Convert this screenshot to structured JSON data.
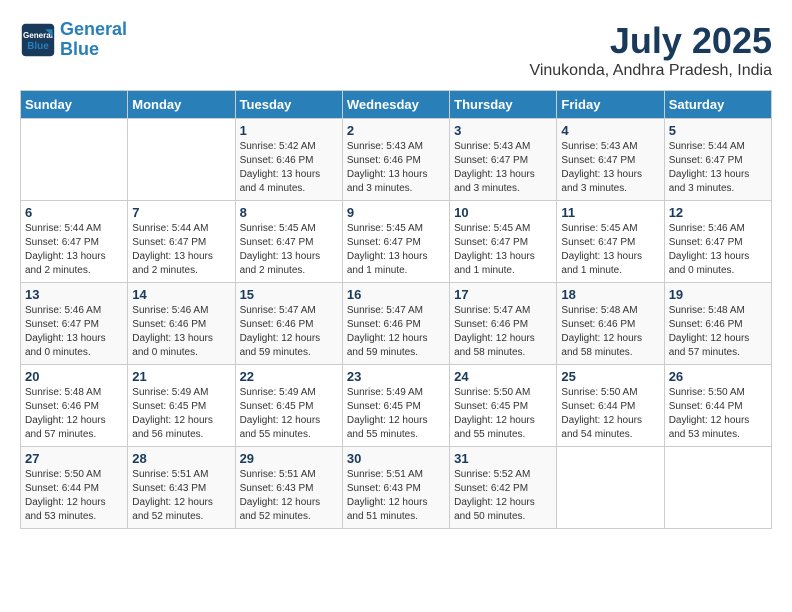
{
  "header": {
    "logo_line1": "General",
    "logo_line2": "Blue",
    "month_title": "July 2025",
    "location": "Vinukonda, Andhra Pradesh, India"
  },
  "days_of_week": [
    "Sunday",
    "Monday",
    "Tuesday",
    "Wednesday",
    "Thursday",
    "Friday",
    "Saturday"
  ],
  "weeks": [
    [
      {
        "day": "",
        "info": ""
      },
      {
        "day": "",
        "info": ""
      },
      {
        "day": "1",
        "info": "Sunrise: 5:42 AM\nSunset: 6:46 PM\nDaylight: 13 hours and 4 minutes."
      },
      {
        "day": "2",
        "info": "Sunrise: 5:43 AM\nSunset: 6:46 PM\nDaylight: 13 hours and 3 minutes."
      },
      {
        "day": "3",
        "info": "Sunrise: 5:43 AM\nSunset: 6:47 PM\nDaylight: 13 hours and 3 minutes."
      },
      {
        "day": "4",
        "info": "Sunrise: 5:43 AM\nSunset: 6:47 PM\nDaylight: 13 hours and 3 minutes."
      },
      {
        "day": "5",
        "info": "Sunrise: 5:44 AM\nSunset: 6:47 PM\nDaylight: 13 hours and 3 minutes."
      }
    ],
    [
      {
        "day": "6",
        "info": "Sunrise: 5:44 AM\nSunset: 6:47 PM\nDaylight: 13 hours and 2 minutes."
      },
      {
        "day": "7",
        "info": "Sunrise: 5:44 AM\nSunset: 6:47 PM\nDaylight: 13 hours and 2 minutes."
      },
      {
        "day": "8",
        "info": "Sunrise: 5:45 AM\nSunset: 6:47 PM\nDaylight: 13 hours and 2 minutes."
      },
      {
        "day": "9",
        "info": "Sunrise: 5:45 AM\nSunset: 6:47 PM\nDaylight: 13 hours and 1 minute."
      },
      {
        "day": "10",
        "info": "Sunrise: 5:45 AM\nSunset: 6:47 PM\nDaylight: 13 hours and 1 minute."
      },
      {
        "day": "11",
        "info": "Sunrise: 5:45 AM\nSunset: 6:47 PM\nDaylight: 13 hours and 1 minute."
      },
      {
        "day": "12",
        "info": "Sunrise: 5:46 AM\nSunset: 6:47 PM\nDaylight: 13 hours and 0 minutes."
      }
    ],
    [
      {
        "day": "13",
        "info": "Sunrise: 5:46 AM\nSunset: 6:47 PM\nDaylight: 13 hours and 0 minutes."
      },
      {
        "day": "14",
        "info": "Sunrise: 5:46 AM\nSunset: 6:46 PM\nDaylight: 13 hours and 0 minutes."
      },
      {
        "day": "15",
        "info": "Sunrise: 5:47 AM\nSunset: 6:46 PM\nDaylight: 12 hours and 59 minutes."
      },
      {
        "day": "16",
        "info": "Sunrise: 5:47 AM\nSunset: 6:46 PM\nDaylight: 12 hours and 59 minutes."
      },
      {
        "day": "17",
        "info": "Sunrise: 5:47 AM\nSunset: 6:46 PM\nDaylight: 12 hours and 58 minutes."
      },
      {
        "day": "18",
        "info": "Sunrise: 5:48 AM\nSunset: 6:46 PM\nDaylight: 12 hours and 58 minutes."
      },
      {
        "day": "19",
        "info": "Sunrise: 5:48 AM\nSunset: 6:46 PM\nDaylight: 12 hours and 57 minutes."
      }
    ],
    [
      {
        "day": "20",
        "info": "Sunrise: 5:48 AM\nSunset: 6:46 PM\nDaylight: 12 hours and 57 minutes."
      },
      {
        "day": "21",
        "info": "Sunrise: 5:49 AM\nSunset: 6:45 PM\nDaylight: 12 hours and 56 minutes."
      },
      {
        "day": "22",
        "info": "Sunrise: 5:49 AM\nSunset: 6:45 PM\nDaylight: 12 hours and 55 minutes."
      },
      {
        "day": "23",
        "info": "Sunrise: 5:49 AM\nSunset: 6:45 PM\nDaylight: 12 hours and 55 minutes."
      },
      {
        "day": "24",
        "info": "Sunrise: 5:50 AM\nSunset: 6:45 PM\nDaylight: 12 hours and 55 minutes."
      },
      {
        "day": "25",
        "info": "Sunrise: 5:50 AM\nSunset: 6:44 PM\nDaylight: 12 hours and 54 minutes."
      },
      {
        "day": "26",
        "info": "Sunrise: 5:50 AM\nSunset: 6:44 PM\nDaylight: 12 hours and 53 minutes."
      }
    ],
    [
      {
        "day": "27",
        "info": "Sunrise: 5:50 AM\nSunset: 6:44 PM\nDaylight: 12 hours and 53 minutes."
      },
      {
        "day": "28",
        "info": "Sunrise: 5:51 AM\nSunset: 6:43 PM\nDaylight: 12 hours and 52 minutes."
      },
      {
        "day": "29",
        "info": "Sunrise: 5:51 AM\nSunset: 6:43 PM\nDaylight: 12 hours and 52 minutes."
      },
      {
        "day": "30",
        "info": "Sunrise: 5:51 AM\nSunset: 6:43 PM\nDaylight: 12 hours and 51 minutes."
      },
      {
        "day": "31",
        "info": "Sunrise: 5:52 AM\nSunset: 6:42 PM\nDaylight: 12 hours and 50 minutes."
      },
      {
        "day": "",
        "info": ""
      },
      {
        "day": "",
        "info": ""
      }
    ]
  ]
}
